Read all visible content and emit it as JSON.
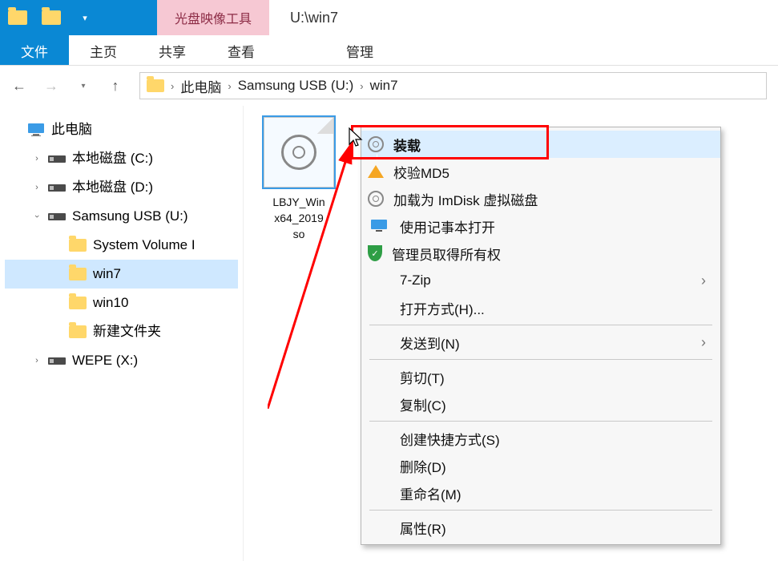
{
  "title": {
    "tool_tab": "光盘映像工具",
    "path_text": "U:\\win7"
  },
  "ribbon": {
    "file": "文件",
    "home": "主页",
    "share": "共享",
    "view": "查看",
    "manage": "管理"
  },
  "breadcrumb": {
    "items": [
      "此电脑",
      "Samsung USB (U:)",
      "win7"
    ]
  },
  "tree": {
    "root": "此电脑",
    "items": [
      {
        "label": "本地磁盘 (C:)",
        "type": "disk"
      },
      {
        "label": "本地磁盘 (D:)",
        "type": "disk"
      },
      {
        "label": "Samsung USB (U:)",
        "type": "disk",
        "expanded": true,
        "children": [
          {
            "label": "System Volume I"
          },
          {
            "label": "win7",
            "active": true
          },
          {
            "label": "win10"
          },
          {
            "label": "新建文件夹"
          }
        ]
      },
      {
        "label": "WEPE (X:)",
        "type": "disk"
      }
    ]
  },
  "content": {
    "file": {
      "line1": "LBJY_Win",
      "line2": "x64_2019",
      "line3": "so"
    }
  },
  "context_menu": {
    "mount": "装载",
    "md5": "校验MD5",
    "imdisk": "加载为 ImDisk 虚拟磁盘",
    "notepad": "使用记事本打开",
    "admin": "管理员取得所有权",
    "sevenzip": "7-Zip",
    "openwith": "打开方式(H)...",
    "sendto": "发送到(N)",
    "cut": "剪切(T)",
    "copy": "复制(C)",
    "shortcut": "创建快捷方式(S)",
    "delete": "删除(D)",
    "rename": "重命名(M)",
    "properties": "属性(R)"
  }
}
